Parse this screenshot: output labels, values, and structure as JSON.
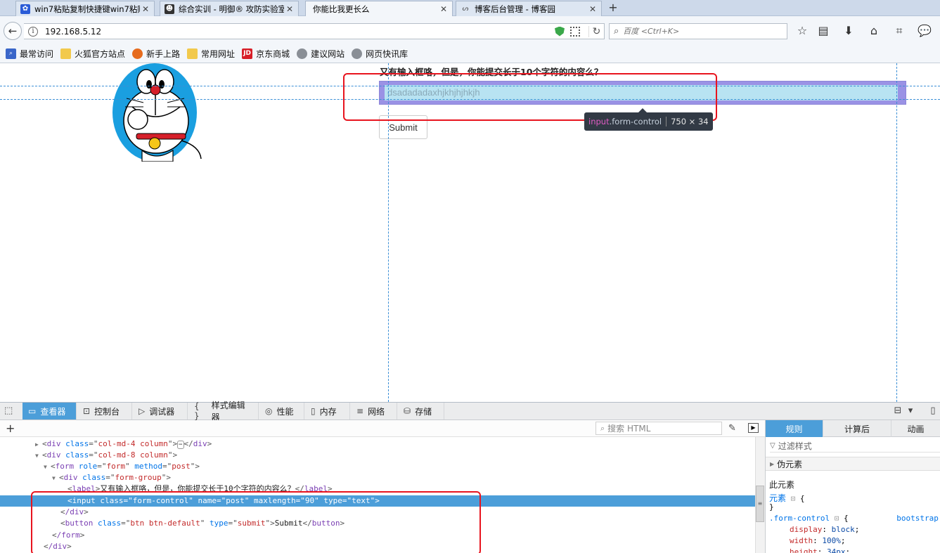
{
  "tabs": [
    {
      "title": "win7粘贴复制快捷键win7粘贴",
      "icon": "paw-icon",
      "active": false
    },
    {
      "title": "综合实训 - 明御® 攻防实验室",
      "icon": "hacker-icon",
      "active": false
    },
    {
      "title": "你能比我更长么",
      "icon": "",
      "active": true
    },
    {
      "title": "博客后台管理 - 博客园",
      "icon": "blog-icon",
      "active": false
    }
  ],
  "navbar": {
    "url": "192.168.5.12",
    "search_placeholder": "百度 <Ctrl+K>"
  },
  "bookmarks": [
    "最常访问",
    "火狐官方站点",
    "新手上路",
    "常用网址",
    "京东商城",
    "建议网站",
    "网页快讯库"
  ],
  "page": {
    "label": "又有输入框咯，但是，你能提交长于10个字符的内容么？",
    "input_value": "dsadadadaxhjkhjhjhkjh",
    "submit_label": "Submit",
    "tooltip": {
      "tag": "input",
      "cls": ".form-control",
      "dims": "750 × 34"
    }
  },
  "devtools": {
    "tabs": [
      "查看器",
      "控制台",
      "调试器",
      "样式编辑器",
      "性能",
      "内存",
      "网络",
      "存储"
    ],
    "search_placeholder": "搜索 HTML",
    "markup": {
      "l1": {
        "tag": "div",
        "attr": "class",
        "val": "col-md-4 column",
        "collapsed": "⋯"
      },
      "l2": {
        "tag": "div",
        "attr": "class",
        "val": "col-md-8 column"
      },
      "l3": {
        "tag": "form",
        "attr1": "role",
        "val1": "form",
        "attr2": "method",
        "val2": "post"
      },
      "l4": {
        "tag": "div",
        "attr": "class",
        "val": "form-group"
      },
      "l5": {
        "tag": "label",
        "text": "又有输入框咯，但是，你能提交长于10个字符的内容么？"
      },
      "l6": {
        "tag": "input",
        "a1": "class",
        "v1": "form-control",
        "a2": "name",
        "v2": "post",
        "a3": "maxlength",
        "v3": "90",
        "a4": "type",
        "v4": "text"
      },
      "l7": {
        "tag": "/div"
      },
      "l8": {
        "tag": "button",
        "a1": "class",
        "v1": "btn btn-default",
        "a2": "type",
        "v2": "submit",
        "text": "Submit"
      },
      "l9": {
        "tag": "/form"
      },
      "l10": {
        "tag": "/div"
      }
    },
    "sidebar": {
      "tabs": [
        "规则",
        "计算后",
        "动画"
      ],
      "filter_placeholder": "过滤样式",
      "pseudo": "伪元素",
      "this_element": "此元素",
      "element_rule": "元素",
      "selector": ".form-control",
      "source": "bootstrap",
      "decl1_prop": "display",
      "decl1_val": "block",
      "decl2_prop": "width",
      "decl2_val": "100%",
      "decl3_prop": "height",
      "decl3_val": "34px"
    }
  },
  "colors": {
    "accent": "#4c9ed9",
    "highlight_red": "#e8141e",
    "node_overlay": "#786edc"
  }
}
